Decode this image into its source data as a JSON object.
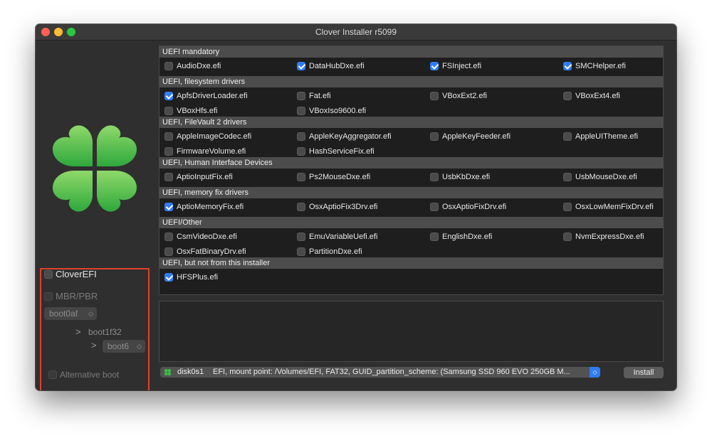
{
  "window": {
    "title": "Clover Installer r5099"
  },
  "left": {
    "clover_efi": {
      "label": "CloverEFI",
      "checked": false
    },
    "mbr_pbr": {
      "label": "MBR/PBR",
      "checked": false
    },
    "boot0_popup": "boot0af",
    "boot1_label": "boot1f32",
    "boot_popup": "boot6",
    "alt_boot": {
      "label": "Alternative boot",
      "checked": false
    },
    "popup_arrows": "◇"
  },
  "sections": [
    {
      "title": "UEFI mandatory",
      "items": [
        {
          "label": "AudioDxe.efi",
          "checked": false
        },
        {
          "label": "DataHubDxe.efi",
          "checked": true
        },
        {
          "label": "FSInject.efi",
          "checked": true
        },
        {
          "label": "SMCHelper.efi",
          "checked": true
        }
      ]
    },
    {
      "title": "UEFI, filesystem drivers",
      "items": [
        {
          "label": "ApfsDriverLoader.efi",
          "checked": true
        },
        {
          "label": "Fat.efi",
          "checked": false
        },
        {
          "label": "VBoxExt2.efi",
          "checked": false
        },
        {
          "label": "VBoxExt4.efi",
          "checked": false
        },
        {
          "label": "VBoxHfs.efi",
          "checked": false
        },
        {
          "label": "VBoxIso9600.efi",
          "checked": false
        }
      ]
    },
    {
      "title": "UEFI, FileVault 2 drivers",
      "items": [
        {
          "label": "AppleImageCodec.efi",
          "checked": false
        },
        {
          "label": "AppleKeyAggregator.efi",
          "checked": false
        },
        {
          "label": "AppleKeyFeeder.efi",
          "checked": false
        },
        {
          "label": "AppleUITheme.efi",
          "checked": false
        },
        {
          "label": "FirmwareVolume.efi",
          "checked": false
        },
        {
          "label": "HashServiceFix.efi",
          "checked": false
        }
      ]
    },
    {
      "title": "UEFI, Human Interface Devices",
      "items": [
        {
          "label": "AptioInputFix.efi",
          "checked": false
        },
        {
          "label": "Ps2MouseDxe.efi",
          "checked": false
        },
        {
          "label": "UsbKbDxe.efi",
          "checked": false
        },
        {
          "label": "UsbMouseDxe.efi",
          "checked": false
        }
      ]
    },
    {
      "title": "UEFI, memory fix drivers",
      "items": [
        {
          "label": "AptioMemoryFix.efi",
          "checked": true
        },
        {
          "label": "OsxAptioFix3Drv.efi",
          "checked": false
        },
        {
          "label": "OsxAptioFixDrv.efi",
          "checked": false
        },
        {
          "label": "OsxLowMemFixDrv.efi",
          "checked": false
        }
      ]
    },
    {
      "title": "UEFI/Other",
      "items": [
        {
          "label": "CsmVideoDxe.efi",
          "checked": false
        },
        {
          "label": "EmuVariableUefi.efi",
          "checked": false
        },
        {
          "label": "EnglishDxe.efi",
          "checked": false
        },
        {
          "label": "NvmExpressDxe.efi",
          "checked": false
        },
        {
          "label": "OsxFatBinaryDrv.efi",
          "checked": false
        },
        {
          "label": "PartitionDxe.efi",
          "checked": false
        }
      ]
    },
    {
      "title": "UEFI, but not from this installer",
      "items": [
        {
          "label": "HFSPlus.efi",
          "checked": true
        }
      ]
    }
  ],
  "footer": {
    "disk_name": "disk0s1",
    "disk_desc": "EFI, mount point: /Volumes/EFI, FAT32, GUID_partition_scheme: (Samsung SSD 960 EVO 250GB M...",
    "disk_arrows": "◇",
    "install_label": "Install"
  },
  "colors": {
    "accent": "#2f7cf6",
    "highlight_border": "#e0412b",
    "clover_green": "#3fb94a"
  }
}
